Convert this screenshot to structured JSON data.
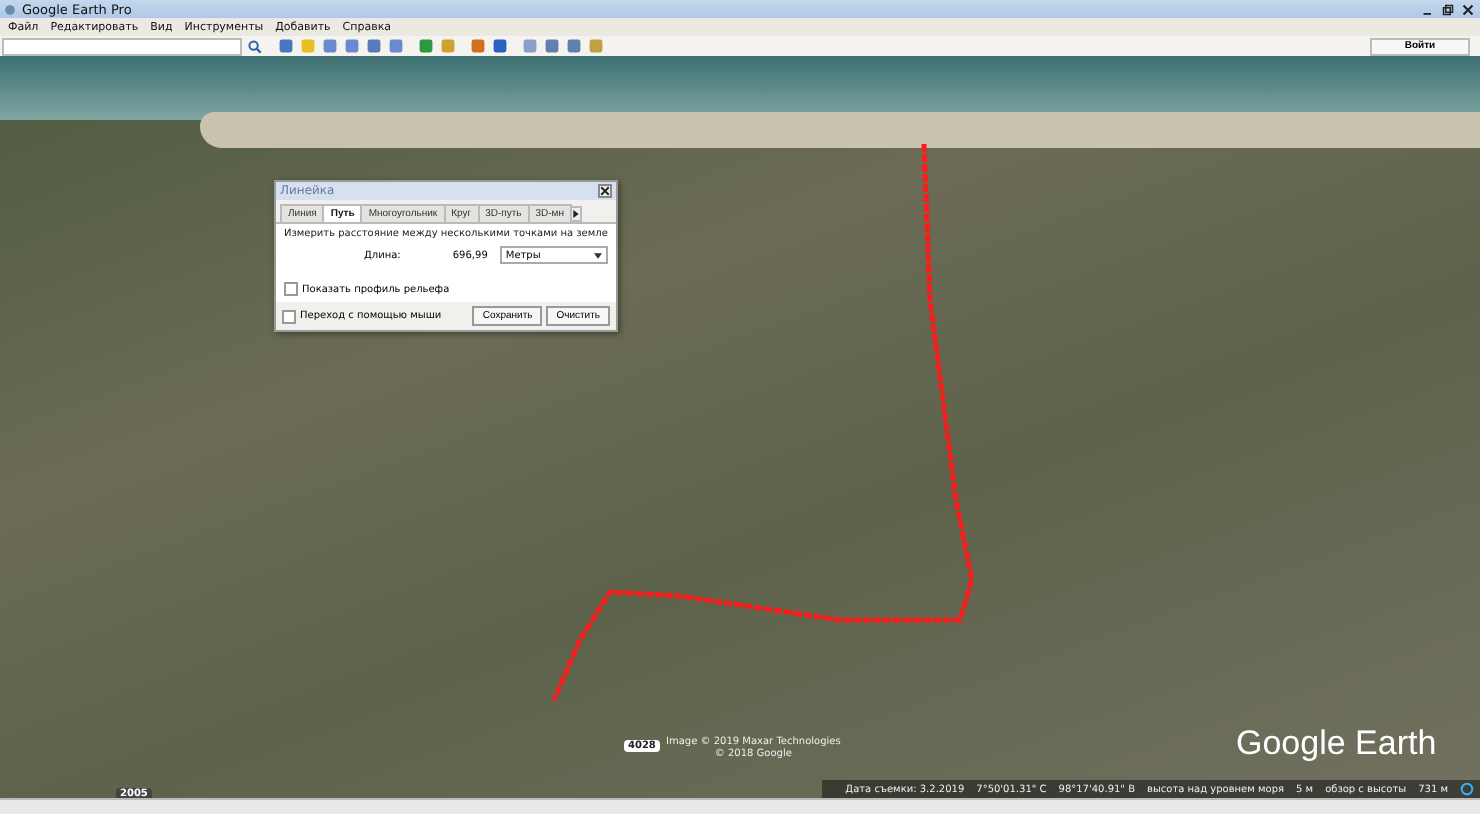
{
  "window": {
    "title": "Google Earth Pro"
  },
  "menu": [
    "Файл",
    "Редактировать",
    "Вид",
    "Инструменты",
    "Добавить",
    "Справка"
  ],
  "toolbar": {
    "sign_in": "Войти"
  },
  "ruler": {
    "title": "Линейка",
    "tabs": [
      {
        "label": "Линия",
        "selected": false
      },
      {
        "label": "Путь",
        "selected": true
      },
      {
        "label": "Многоугольник",
        "selected": false
      },
      {
        "label": "Круг",
        "selected": false
      },
      {
        "label": "3D-путь",
        "selected": false
      },
      {
        "label": "3D-мн",
        "selected": false
      }
    ],
    "description": "Измерить расстояние между несколькими точками на земле",
    "length_label": "Длина:",
    "length_value": "696,99",
    "unit": "Метры",
    "show_profile": {
      "label": "Показать профиль рельефа",
      "checked": false
    },
    "mouse_nav": {
      "label": "Переход с помощью мыши",
      "checked": false
    },
    "buttons": [
      "Сохранить",
      "Очистить"
    ]
  },
  "map": {
    "road_badges": [
      "4028",
      "2005"
    ],
    "attribution": [
      "Image © 2019 Maxar Technologies",
      "© 2018 Google"
    ],
    "logo": "Google Earth"
  },
  "status_bar": [
    "Дата съемки: 3.2.2019",
    "7°50'01.31\" С",
    "98°17'40.91\" В",
    "высота над уровнем моря",
    "5 м",
    "обзор с высоты",
    "731 м"
  ]
}
